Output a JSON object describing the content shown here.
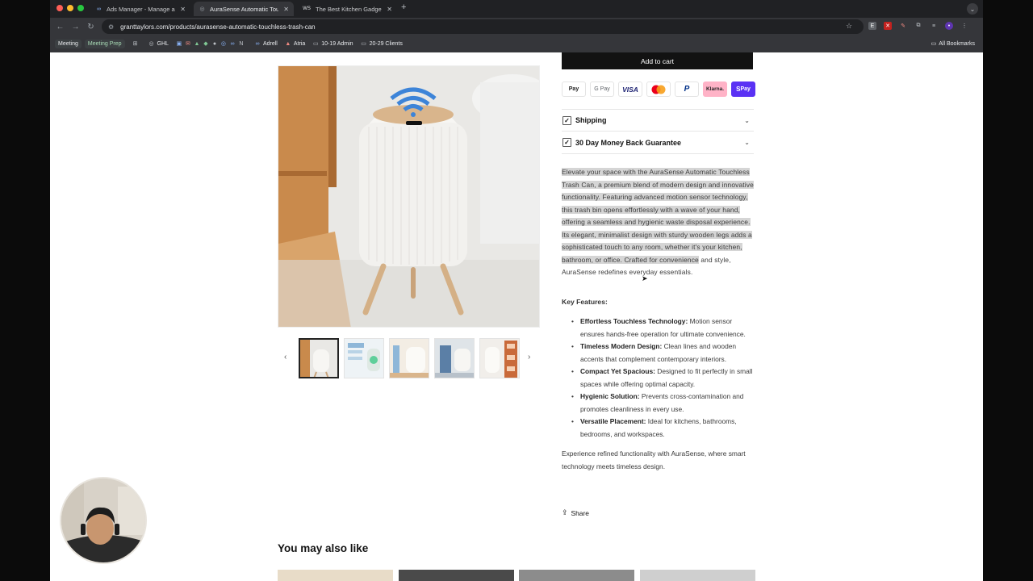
{
  "browser": {
    "tabs": [
      {
        "label": "Ads Manager - Manage ads -",
        "icon": "meta-icon"
      },
      {
        "label": "AuraSense Automatic Touchle",
        "icon": "globe-icon"
      },
      {
        "label": "The Best Kitchen Gadgets &",
        "icon": "ws-icon"
      }
    ],
    "tab_ws_glyph": "WS",
    "new_tab": "+",
    "tab_menu": "⌄",
    "url": "granttaylors.com/products/aurasense-automatic-touchless-trash-can",
    "bookmarks": [
      {
        "label": "Meeting",
        "style": "pill"
      },
      {
        "label": "Meeting Prep",
        "style": "pill-green"
      },
      {
        "label": "GHL",
        "icon": "globe-icon"
      },
      {
        "label": "Adrell",
        "icon": "meta-icon"
      },
      {
        "label": "Atria",
        "icon": "atria-icon"
      },
      {
        "label": "10-19 Admin",
        "icon": "folder-icon"
      },
      {
        "label": "20-29 Clients",
        "icon": "folder-icon"
      }
    ],
    "all_bookmarks": "All Bookmarks"
  },
  "product": {
    "add_to_cart": "Add to cart",
    "payment_methods": [
      "Pay",
      "G Pay",
      "VISA",
      "",
      "P",
      "Klarna.",
      "Pay"
    ],
    "accordions": [
      "Shipping",
      "30 Day Money Back Guarantee"
    ],
    "description_highlighted": "Elevate your space with the AuraSense Automatic Touchless Trash Can, a premium blend of modern design and innovative functionality. Featuring advanced motion sensor technology, this trash bin opens effortlessly with a wave of your hand, offering a seamless and hygienic waste disposal experience. Its elegant, minimalist design with sturdy wooden legs adds a sophisticated touch to any room, whether it's your kitchen, bathroom, or office. Crafted for convenience",
    "description_rest": " and style, AuraSense redefines everyday essentials.",
    "key_features_title": "Key Features:",
    "features": [
      {
        "title": "Effortless Touchless Technology:",
        "text": " Motion sensor ensures hands-free operation for ultimate convenience."
      },
      {
        "title": "Timeless Modern Design:",
        "text": " Clean lines and wooden accents that complement contemporary interiors."
      },
      {
        "title": "Compact Yet Spacious:",
        "text": " Designed to fit perfectly in small spaces while offering optimal capacity."
      },
      {
        "title": "Hygienic Solution:",
        "text": " Prevents cross-contamination and promotes cleanliness in every use."
      },
      {
        "title": "Versatile Placement:",
        "text": " Ideal for kitchens, bathrooms, bedrooms, and workspaces."
      }
    ],
    "closing": "Experience refined functionality with AuraSense, where smart technology meets timeless design.",
    "share": "Share"
  },
  "recommendations": {
    "title": "You may also like"
  },
  "colors": {
    "accent": "#121212",
    "klarna": "#ffb3c7",
    "shop_pay": "#5a31f4",
    "highlight": "#d5d5d5"
  }
}
